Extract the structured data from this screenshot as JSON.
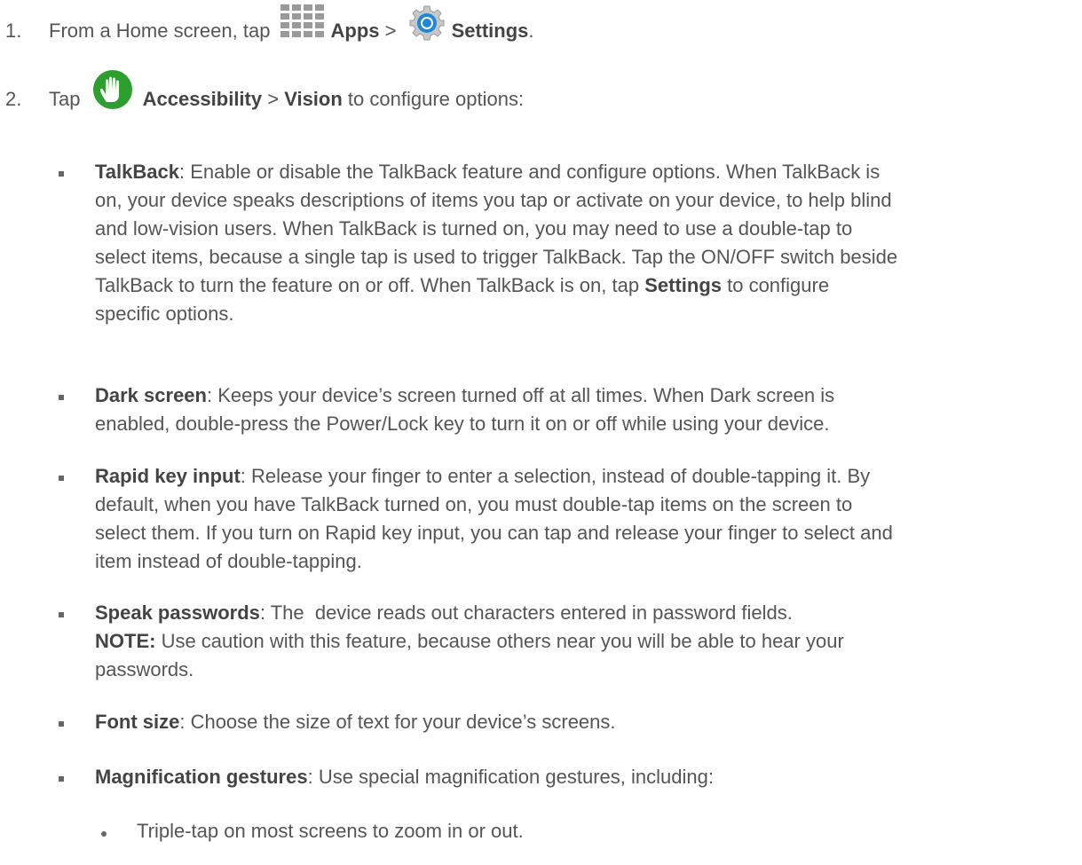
{
  "steps": [
    {
      "number": "1.",
      "text_a": "From a Home screen, tap ",
      "apps_label": "Apps",
      "sep": " > ",
      "settings_label": "Settings",
      "end": "."
    },
    {
      "number": "2.",
      "text_a": "Tap ",
      "accessibility_label": "Accessibility",
      "sep": " > ",
      "vision_label": "Vision",
      "end": " to configure options:"
    }
  ],
  "bullets": [
    {
      "term": "TalkBack",
      "lines": [
        ": Enable or disable the TalkBack feature and configure options. When TalkBack is",
        "on, your device speaks descriptions of items you tap or activate on your device, to help blind",
        "and low-vision users. When TalkBack is turned on, you may need to use a double-tap to",
        "select items, because a single tap is used to trigger TalkBack. Tap the ON/OFF switch beside",
        "TalkBack to turn the feature on or off. When TalkBack is on, tap ",
        "specific options."
      ],
      "settings_bold": "Settings",
      "settings_after": " to configure"
    },
    {
      "term": "Dark screen",
      "lines": [
        ": Keeps your device’s screen turned off at all times. When Dark screen is",
        "enabled, double-press the Power/Lock key to turn it on or off while using your device."
      ]
    },
    {
      "term": "Rapid key input",
      "lines": [
        ": Release your finger to enter a selection, instead of double-tapping it. By",
        "default, when you have TalkBack turned on, you must double-tap items on the screen to",
        "select them. If you turn on Rapid key input, you can tap and release your finger to select and",
        "item instead of double-tapping."
      ]
    },
    {
      "term": "Speak passwords",
      "lines": [
        ": The  device reads out characters entered in password fields.",
        " Use caution with this feature, because others near you will be able to hear your",
        "passwords."
      ],
      "note_label": "NOTE:"
    },
    {
      "term": "Font size",
      "lines": [
        ": Choose the size of text for your device’s screens."
      ]
    },
    {
      "term": "Magnification gestures",
      "lines": [
        ": Use special magnification gestures, including:"
      ]
    }
  ],
  "sub_bullets": [
    "Triple-tap on most screens to zoom in or out."
  ],
  "icons": {
    "apps": "apps-grid-icon",
    "settings": "settings-gear-icon",
    "accessibility": "accessibility-hand-icon"
  },
  "colors": {
    "text": "#555555",
    "bold": "#444444",
    "accessibility_green": "#2e9e2e",
    "settings_blue": "#1e88d8",
    "apps_gray": "#9a9a9a"
  }
}
